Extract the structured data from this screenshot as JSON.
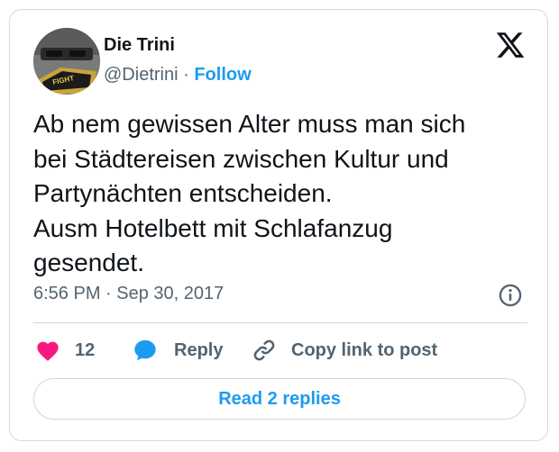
{
  "author": {
    "name": "Die Trini",
    "handle": "@Dietrini",
    "separator": "·",
    "follow_label": "Follow"
  },
  "tweet": {
    "text": "Ab nem gewissen Alter muss man sich\nbei Städtereisen zwischen Kultur und\nPartynächten entscheiden.\nAusm Hotelbett mit Schlafanzug\ngesendet.",
    "timestamp": "6:56 PM · Sep 30, 2017"
  },
  "actions": {
    "like_count": "12",
    "reply_label": "Reply",
    "copy_link_label": "Copy link to post"
  },
  "read_replies_label": "Read 2 replies",
  "icons": {
    "brand": "x-logo-icon",
    "info": "info-icon",
    "like": "heart-icon",
    "reply": "speech-bubble-icon",
    "link": "link-icon"
  },
  "colors": {
    "accent": "#1d9bf0",
    "like": "#f91880",
    "text_primary": "#0f1419",
    "text_secondary": "#536471",
    "border": "#cfd9de"
  }
}
